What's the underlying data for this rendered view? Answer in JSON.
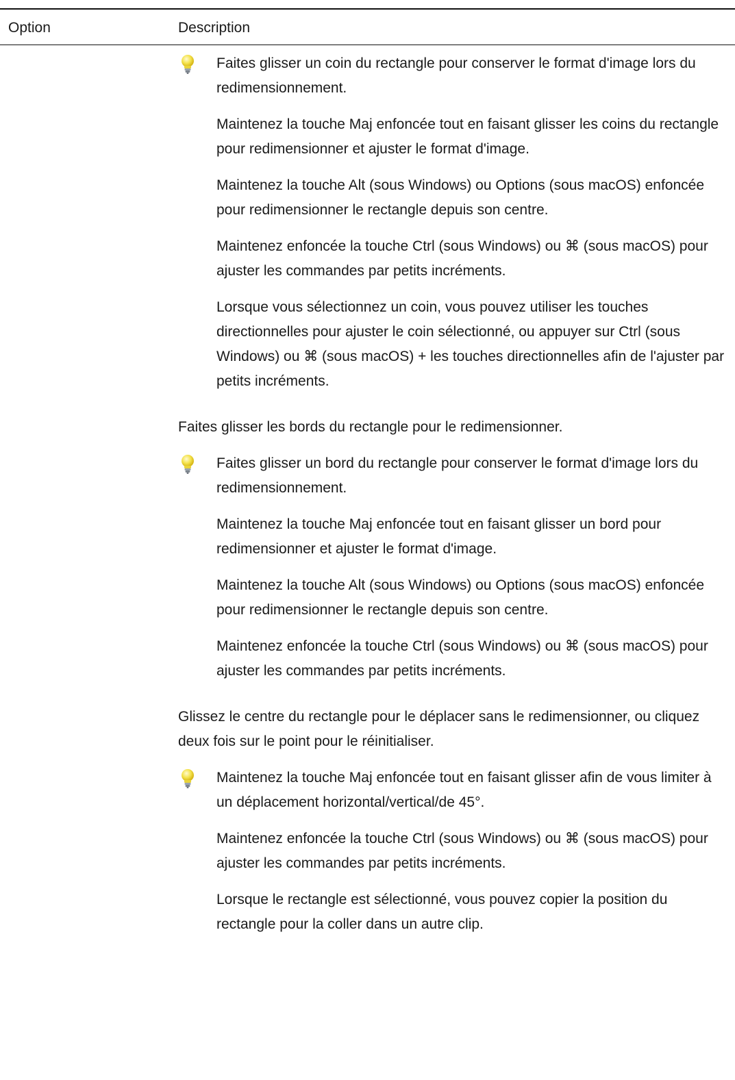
{
  "table": {
    "headers": {
      "option": "Option",
      "description": "Description"
    }
  },
  "icons": {
    "tip": "lightbulb-icon"
  },
  "colors": {
    "bulb": "#f4e24a",
    "bulb_base": "#9aa3ad",
    "text": "#1a1a1a",
    "rule": "#111111"
  },
  "description": {
    "tip_corners": [
      "Faites glisser un coin du rectangle pour conserver le format d'image lors du redimensionnement.",
      "Maintenez la touche Maj enfoncée tout en faisant glisser les coins du rectangle pour redimensionner et ajuster le format d'image.",
      "Maintenez la touche Alt (sous Windows) ou Options (sous macOS) enfoncée pour redimensionner le rectangle depuis son centre.",
      "Maintenez enfoncée la touche Ctrl (sous Windows) ou ⌘  (sous macOS) pour ajuster les commandes par petits incréments.",
      "Lorsque vous sélectionnez un coin, vous pouvez utiliser les touches directionnelles pour ajuster le coin sélectionné, ou appuyer sur Ctrl (sous Windows) ou ⌘  (sous macOS) + les touches directionnelles afin de l'ajuster par petits incréments."
    ],
    "edges_intro": "Faites glisser les bords du rectangle pour le redimensionner.",
    "tip_edges": [
      "Faites glisser un bord du rectangle pour conserver le format d'image lors du redimensionnement.",
      "Maintenez la touche Maj enfoncée tout en faisant glisser un bord pour redimensionner et ajuster le format d'image.",
      "Maintenez la touche Alt (sous Windows) ou Options (sous macOS) enfoncée pour redimensionner le rectangle depuis son centre.",
      "Maintenez enfoncée la touche Ctrl (sous Windows) ou ⌘  (sous macOS) pour ajuster les commandes par petits incréments."
    ],
    "center_intro": "Glissez le centre du rectangle pour le déplacer sans le redimensionner, ou cliquez deux fois sur le point pour le réinitialiser.",
    "tip_center": [
      "Maintenez la touche Maj enfoncée tout en faisant glisser afin de vous limiter à un déplacement horizontal/vertical/de 45°.",
      "Maintenez enfoncée la touche Ctrl (sous Windows) ou ⌘  (sous macOS) pour ajuster les commandes par petits incréments.",
      "Lorsque le rectangle est sélectionné, vous pouvez copier la position du rectangle pour la coller dans un autre clip."
    ]
  }
}
